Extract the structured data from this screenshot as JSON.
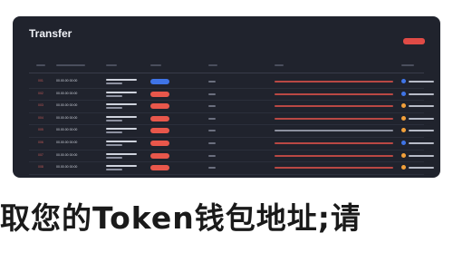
{
  "window": {
    "title": "Transfer"
  },
  "colors": {
    "panel": "#20232d",
    "accent_red": "#e04b46",
    "accent_blue": "#3f74e6",
    "accent_orange": "#f2a03a"
  },
  "rows": [
    {
      "rank": "001",
      "date": "00.00.00 00:00",
      "pill": "blue",
      "bar": "red",
      "dot": "blue"
    },
    {
      "rank": "002",
      "date": "00.00.00 00:00",
      "pill": "red",
      "bar": "red",
      "dot": "blue"
    },
    {
      "rank": "003",
      "date": "00.00.00 00:00",
      "pill": "red",
      "bar": "red",
      "dot": "orange"
    },
    {
      "rank": "004",
      "date": "00.00.00 00:00",
      "pill": "red",
      "bar": "red",
      "dot": "orange"
    },
    {
      "rank": "005",
      "date": "00.00.00 00:00",
      "pill": "red",
      "bar": "gray",
      "dot": "orange"
    },
    {
      "rank": "006",
      "date": "00.00.00 00:00",
      "pill": "red",
      "bar": "red",
      "dot": "blue"
    },
    {
      "rank": "007",
      "date": "00.00.00 00:00",
      "pill": "red",
      "bar": "red",
      "dot": "orange"
    },
    {
      "rank": "008",
      "date": "00.00.00 00:00",
      "pill": "red",
      "bar": "red",
      "dot": "orange"
    }
  ],
  "caption": "取您的Token钱包地址;请"
}
